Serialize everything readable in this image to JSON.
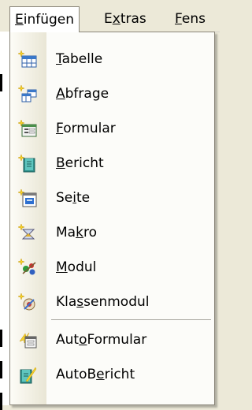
{
  "menubar": {
    "items": [
      {
        "label": "Einfügen",
        "active": true
      },
      {
        "label": "Extras",
        "active": false
      },
      {
        "label": "Fens",
        "active": false
      }
    ]
  },
  "menu": {
    "items": [
      {
        "label": "Tabelle",
        "underline": "T",
        "icon": "table-new-icon"
      },
      {
        "label": "Abfrage",
        "underline": "A",
        "icon": "query-new-icon"
      },
      {
        "label": "Formular",
        "underline": "F",
        "icon": "form-new-icon"
      },
      {
        "label": "Bericht",
        "underline": "B",
        "icon": "report-new-icon"
      },
      {
        "label": "Seite",
        "underline": "i",
        "icon": "page-new-icon"
      },
      {
        "label": "Makro",
        "underline": "k",
        "icon": "macro-new-icon"
      },
      {
        "label": "Modul",
        "underline": "M",
        "icon": "module-new-icon"
      },
      {
        "label": "Klassenmodul",
        "underline": "s",
        "icon": "class-module-new-icon"
      },
      {
        "label": "AutoFormular",
        "underline": "o",
        "icon": "autoform-icon"
      },
      {
        "label": "AutoBericht",
        "underline": "e",
        "icon": "autoreport-icon"
      }
    ]
  },
  "colors": {
    "menu_background": "#fcfcf9",
    "menubar_background": "#ece9d8",
    "border": "#8a867a"
  }
}
